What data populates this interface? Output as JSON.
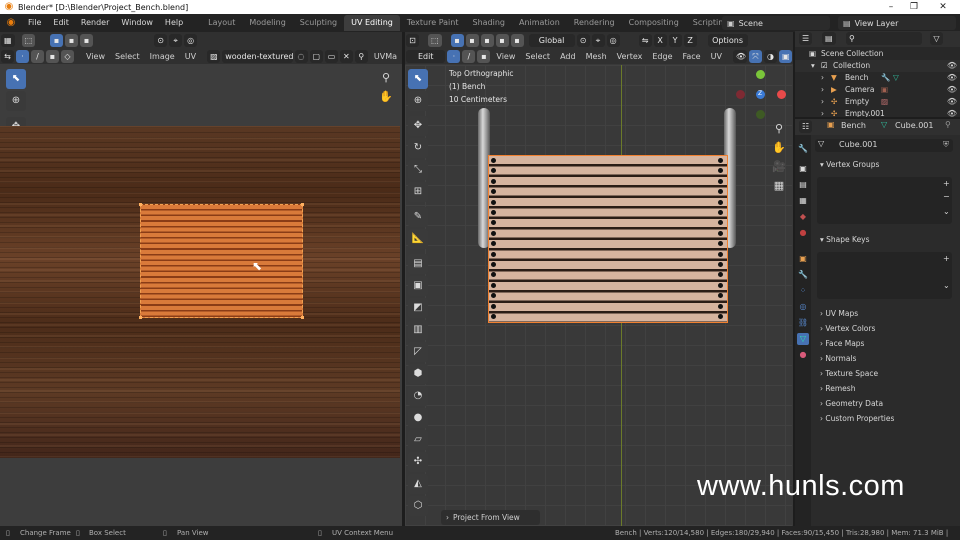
{
  "window": {
    "title": "Blender* [D:\\Blender\\Project_Bench.blend]",
    "controls": [
      "–",
      "❐",
      "✕"
    ]
  },
  "menus": [
    "File",
    "Edit",
    "Render",
    "Window",
    "Help"
  ],
  "workspaces": [
    {
      "label": "Layout",
      "active": false
    },
    {
      "label": "Modeling",
      "active": false
    },
    {
      "label": "Sculpting",
      "active": false
    },
    {
      "label": "UV Editing",
      "active": true
    },
    {
      "label": "Texture Paint",
      "active": false
    },
    {
      "label": "Shading",
      "active": false
    },
    {
      "label": "Animation",
      "active": false
    },
    {
      "label": "Rendering",
      "active": false
    },
    {
      "label": "Compositing",
      "active": false
    },
    {
      "label": "Scripting",
      "active": false
    }
  ],
  "scene": {
    "name": "Scene",
    "view_layer": "View Layer"
  },
  "uv_editor": {
    "menus": [
      "View",
      "Select",
      "Image",
      "UV"
    ],
    "image_name": "wooden-textured-b...",
    "uvmap_label": "UVMa"
  },
  "viewport": {
    "mode": "Edit Mode",
    "menus": [
      "View",
      "Select",
      "Add",
      "Mesh",
      "Vertex",
      "Edge",
      "Face",
      "UV"
    ],
    "orientation": "Global",
    "axes": [
      "X",
      "Y",
      "Z"
    ],
    "options_label": "Options",
    "overlay_lines": [
      "Top Orthographic",
      "(1) Bench",
      "10 Centimeters"
    ],
    "gizmo": {
      "z_label": "Z",
      "x_color": "#e84a4a",
      "y_color": "#7ac53a",
      "z_color": "#3b7bd6"
    },
    "redo_panel": "Project From View"
  },
  "outliner": {
    "search_placeholder": "",
    "rows": [
      {
        "name": "Scene Collection",
        "indent": 0
      },
      {
        "name": "Collection",
        "indent": 1
      },
      {
        "name": "Bench",
        "indent": 2
      },
      {
        "name": "Camera",
        "indent": 2
      },
      {
        "name": "Empty",
        "indent": 2
      },
      {
        "name": "Empty.001",
        "indent": 2
      }
    ]
  },
  "properties": {
    "object_name": "Bench",
    "data_name": "Cube.001",
    "mesh_field": "Cube.001",
    "panels": [
      {
        "label": "Vertex Groups",
        "open": true
      },
      {
        "label": "Shape Keys",
        "open": true
      },
      {
        "label": "UV Maps",
        "open": false
      },
      {
        "label": "Vertex Colors",
        "open": false
      },
      {
        "label": "Face Maps",
        "open": false
      },
      {
        "label": "Normals",
        "open": false
      },
      {
        "label": "Texture Space",
        "open": false
      },
      {
        "label": "Remesh",
        "open": false
      },
      {
        "label": "Geometry Data",
        "open": false
      },
      {
        "label": "Custom Properties",
        "open": false
      }
    ]
  },
  "statusbar": {
    "change_frame": "Change Frame",
    "box_select": "Box Select",
    "pan_view": "Pan View",
    "uv_context": "UV Context Menu",
    "stats": "Bench | Verts:120/14,580 | Edges:180/29,940 | Faces:90/15,450 | Tris:28,980 | Mem: 71.3 MiB | 2.83.0"
  },
  "watermark": "www.hunls.com",
  "colors": {
    "accent": "#4772b3",
    "active_edge": "#f08030",
    "uv_wood": "#d97a3a"
  }
}
